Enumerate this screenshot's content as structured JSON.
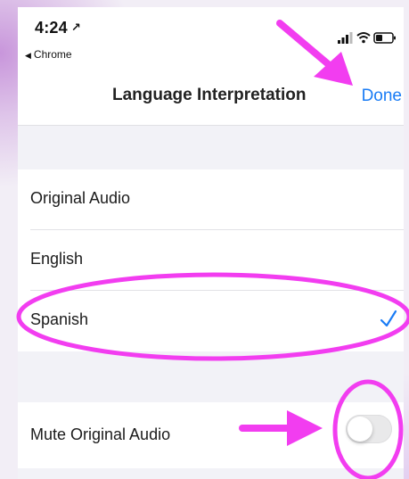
{
  "status_bar": {
    "time": "4:24",
    "back_app": "Chrome",
    "location_glyph": "↗"
  },
  "nav": {
    "title": "Language Interpretation",
    "done_label": "Done"
  },
  "languages": {
    "items": [
      {
        "label": "Original Audio",
        "selected": false
      },
      {
        "label": "English",
        "selected": false
      },
      {
        "label": "Spanish",
        "selected": true
      }
    ]
  },
  "settings": {
    "mute_label": "Mute Original Audio",
    "mute_enabled": false
  },
  "colors": {
    "accent": "#1a7cf5",
    "annotation": "#f23df0",
    "check": "#1a7cf5"
  },
  "icons": {
    "location": "location-arrow-icon",
    "back": "back-triangle-icon",
    "signal": "cellular-signal-icon",
    "wifi": "wifi-icon",
    "battery": "battery-icon",
    "checkmark": "checkmark-icon"
  }
}
